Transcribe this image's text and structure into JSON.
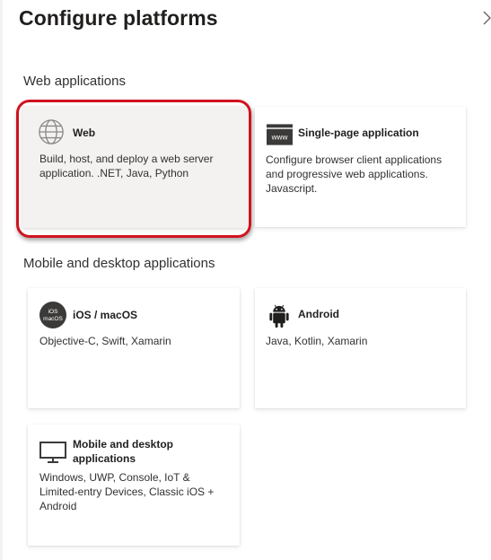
{
  "title": "Configure platforms",
  "sections": {
    "web": {
      "heading": "Web applications"
    },
    "mobile": {
      "heading": "Mobile and desktop applications"
    }
  },
  "cards": {
    "web": {
      "title": "Web",
      "description": "Build, host, and deploy a web server application. .NET, Java, Python",
      "icon": "globe-icon"
    },
    "spa": {
      "title": "Single-page application",
      "description": "Configure browser client applications and progressive web applications. Javascript.",
      "icon": "www-browser-icon",
      "icon_text": "www"
    },
    "ios": {
      "title": "iOS / macOS",
      "description": "Objective-C, Swift, Xamarin",
      "icon": "ios-macos-icon",
      "icon_text_top": "iOS",
      "icon_text_bottom": "macOS"
    },
    "android": {
      "title": "Android",
      "description": "Java, Kotlin, Xamarin",
      "icon": "android-icon"
    },
    "desktop": {
      "title": "Mobile and desktop applications",
      "description": "Windows, UWP, Console, IoT & Limited-entry Devices, Classic iOS + Android",
      "icon": "desktop-monitor-icon"
    }
  },
  "colors": {
    "highlight": "#d0131e",
    "selected_card_bg": "#f3f2f1",
    "icon_dark": "#3b3a39"
  }
}
